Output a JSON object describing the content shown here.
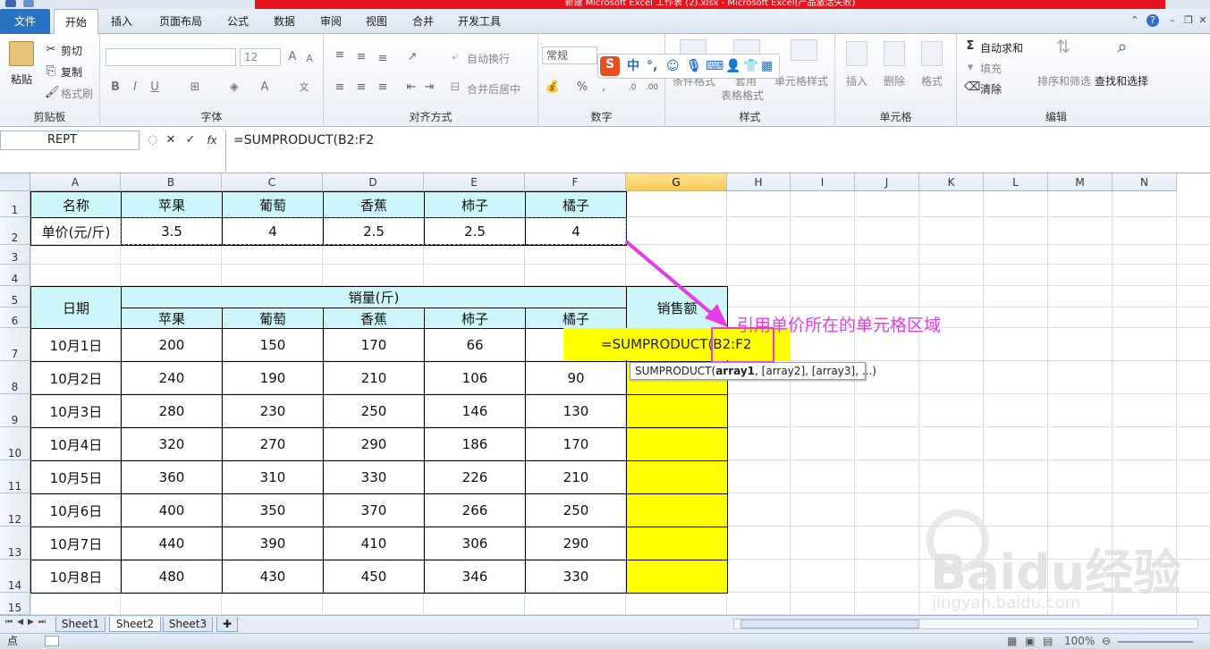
{
  "window": {
    "title": "新建 Microsoft Excel 工作表 (2).xlsx - Microsoft Excel(产品激活失败)"
  },
  "tabs": [
    "文件",
    "开始",
    "插入",
    "页面布局",
    "公式",
    "数据",
    "审阅",
    "视图",
    "合并",
    "开发工具"
  ],
  "ribbon": {
    "clipboard": {
      "label": "剪贴板",
      "paste": "粘贴",
      "cut": "剪切",
      "copy": "复制",
      "format_painter": "格式刷"
    },
    "font": {
      "label": "字体",
      "size": "12",
      "bold": "B",
      "italic": "I",
      "underline": "U"
    },
    "alignment": {
      "label": "对齐方式",
      "wrap": "自动换行",
      "merge": "合并后居中"
    },
    "number": {
      "label": "数字",
      "format": "常规",
      "percent": "%"
    },
    "styles": {
      "label": "样式",
      "conditional": "条件格式",
      "table_format_1": "套用",
      "table_format_2": "表格格式",
      "cell_styles": "单元格样式"
    },
    "cells": {
      "label": "单元格",
      "insert": "插入",
      "delete": "删除",
      "format": "格式"
    },
    "editing": {
      "label": "编辑",
      "autosum": "自动求和",
      "fill": "填充",
      "clear": "清除",
      "sort_filter": "排序和筛选",
      "find_select": "查找和选择"
    }
  },
  "sogou": {
    "s": "S",
    "mode": "中"
  },
  "formula_bar": {
    "name_box": "REPT",
    "fx": "fx",
    "formula": "=SUMPRODUCT(B2:F2"
  },
  "columns": [
    "A",
    "B",
    "C",
    "D",
    "E",
    "F",
    "G",
    "H",
    "I",
    "J",
    "K",
    "L",
    "M",
    "N"
  ],
  "rows": [
    "1",
    "2",
    "3",
    "4",
    "5",
    "6",
    "7",
    "8",
    "9",
    "10",
    "11",
    "12",
    "13",
    "14",
    "15"
  ],
  "price_table": {
    "header": [
      "名称",
      "苹果",
      "葡萄",
      "香蕉",
      "柿子",
      "橘子"
    ],
    "values": [
      "单价(元/斤)",
      "3.5",
      "4",
      "2.5",
      "2.5",
      "4"
    ]
  },
  "sales_table": {
    "date_header": "日期",
    "group_header": "销量(斤)",
    "amount_header": "销售额",
    "fruits": [
      "苹果",
      "葡萄",
      "香蕉",
      "柿子",
      "橘子"
    ],
    "rows": [
      {
        "date": "10月1日",
        "values": [
          "200",
          "150",
          "170",
          "66",
          ""
        ]
      },
      {
        "date": "10月2日",
        "values": [
          "240",
          "190",
          "210",
          "106",
          "90"
        ]
      },
      {
        "date": "10月3日",
        "values": [
          "280",
          "230",
          "250",
          "146",
          "130"
        ]
      },
      {
        "date": "10月4日",
        "values": [
          "320",
          "270",
          "290",
          "186",
          "170"
        ]
      },
      {
        "date": "10月5日",
        "values": [
          "360",
          "310",
          "330",
          "226",
          "210"
        ]
      },
      {
        "date": "10月6日",
        "values": [
          "400",
          "350",
          "370",
          "266",
          "250"
        ]
      },
      {
        "date": "10月7日",
        "values": [
          "440",
          "390",
          "410",
          "306",
          "290"
        ]
      },
      {
        "date": "10月8日",
        "values": [
          "480",
          "430",
          "450",
          "346",
          "330"
        ]
      }
    ]
  },
  "edit_cell": {
    "text": "=SUMPRODUCT(B2:F2"
  },
  "tooltip": {
    "fn": "SUMPRODUCT(",
    "arg1": "array1",
    "rest": ", [array2], [array3], ...)"
  },
  "annotation": {
    "text": "引用单价所在的单元格区域",
    "color": "#e83be8"
  },
  "sheets": [
    "Sheet1",
    "Sheet2",
    "Sheet3"
  ],
  "status": {
    "mode": "点",
    "zoom": "100%"
  },
  "watermark": {
    "text": "Baidu经验",
    "sub": "jingyan.baidu.com"
  }
}
